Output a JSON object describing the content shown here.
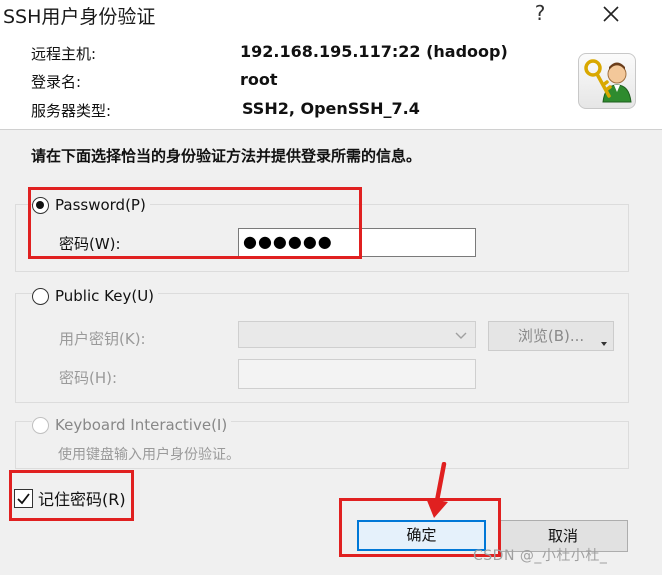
{
  "window": {
    "title": "SSH用户身份验证",
    "help_label": "?",
    "close_icon": "close-icon"
  },
  "info": {
    "host_label": "远程主机:",
    "host_value": "192.168.195.117:22 (hadoop)",
    "login_label": "登录名:",
    "login_value": "root",
    "server_type_label": "服务器类型:",
    "server_type_value": "SSH2, OpenSSH_7.4",
    "icon": "user-key-icon"
  },
  "instruction": "请在下面选择恰当的身份验证方法并提供登录所需的信息。",
  "password_method": {
    "label": "Password(P)",
    "selected": true,
    "field_label": "密码(W):",
    "field_value": "●●●●●●"
  },
  "public_key_method": {
    "label": "Public Key(U)",
    "selected": false,
    "key_label": "用户密钥(K):",
    "key_value": "",
    "browse_label": "浏览(B)...",
    "passphrase_label": "密码(H):",
    "passphrase_value": ""
  },
  "keyboard_method": {
    "label": "Keyboard Interactive(I)",
    "selected": false,
    "description": "使用键盘输入用户身份验证。"
  },
  "remember": {
    "label": "记住密码(R)",
    "checked": true
  },
  "buttons": {
    "ok_label": "确定",
    "cancel_label": "取消"
  },
  "watermark": "CSDN @_小杜小杜_",
  "colors": {
    "annotation_red": "#e02020",
    "default_button_border": "#0078d7"
  }
}
